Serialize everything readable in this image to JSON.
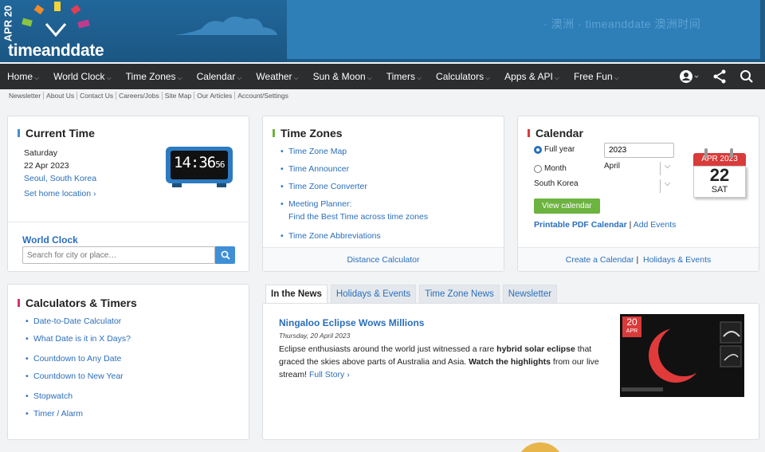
{
  "header": {
    "logo_date": "APR 20",
    "logo_text": "timeanddate",
    "banner_text": "· 澳洲 · timeanddate 澳洲时间"
  },
  "nav": {
    "items": [
      "Home",
      "World Clock",
      "Time Zones",
      "Calendar",
      "Weather",
      "Sun & Moon",
      "Timers",
      "Calculators",
      "Apps & API",
      "Free Fun"
    ]
  },
  "subnav": [
    "Newsletter",
    "About Us",
    "Contact Us",
    "Careers/Jobs",
    "Site Map",
    "Our Articles",
    "Account/Settings"
  ],
  "current_time": {
    "title": "Current Time",
    "weekday": "Saturday",
    "date": "22 Apr 2023",
    "location": "Seoul, South Korea",
    "set_home": "Set home location",
    "clock_main": "14:36",
    "clock_sec": "56",
    "world_clock_label": "World Clock",
    "search_placeholder": "Search for city or place…"
  },
  "time_zones": {
    "title": "Time Zones",
    "links": [
      "Time Zone Map",
      "Time Announcer",
      "Time Zone Converter",
      "Meeting Planner:",
      "Find the Best Time across time zones",
      "Time Zone Abbreviations"
    ],
    "footer": "Distance Calculator"
  },
  "calendar": {
    "title": "Calendar",
    "radio_full_year": "Full year",
    "radio_month": "Month",
    "year_value": "2023",
    "month_value": "April",
    "country_value": "South Korea",
    "view_button": "View calendar",
    "printable": "Printable PDF Calendar",
    "sep": "|",
    "add_events": "Add Events",
    "icon_month": "APR",
    "icon_year": "2023",
    "icon_day": "22",
    "icon_weekday": "SAT",
    "footer_create": "Create a Calendar",
    "footer_holidays": "Holidays & Events"
  },
  "calculators": {
    "title": "Calculators & Timers",
    "links": [
      "Date-to-Date Calculator",
      "What Date is it in X Days?",
      "Countdown to Any Date",
      "Countdown to New Year",
      "Stopwatch",
      "Timer / Alarm"
    ]
  },
  "news": {
    "tabs": [
      "In the News",
      "Holidays & Events",
      "Time Zone News",
      "Newsletter"
    ],
    "headline": "Ningaloo Eclipse Wows Millions",
    "date": "Thursday, 20 April 2023",
    "body_1": "Eclipse enthusiasts around the world just witnessed a rare ",
    "body_bold_1": "hybrid solar eclipse",
    "body_2": " that graced the skies above parts of Australia and Asia. ",
    "body_bold_2": "Watch the highlights",
    "body_3": " from our live stream! ",
    "full_story": "Full Story",
    "thumb_day": "20",
    "thumb_month": "APR"
  },
  "colors": {
    "accent_current": "#3f8fd6",
    "accent_timezones": "#6cb33f",
    "accent_calendar": "#d93a3a",
    "accent_calc": "#d6336c",
    "link": "#2a6ebb"
  }
}
